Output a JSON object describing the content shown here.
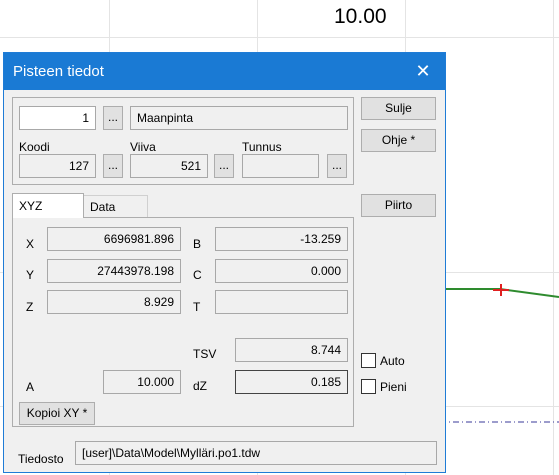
{
  "background": {
    "value_label": "10.00"
  },
  "dialog": {
    "title": "Pisteen tiedot",
    "close_symbol": "✕",
    "point_number": "1",
    "browse_label": "...",
    "point_name": "Maanpinta",
    "koodi": {
      "label": "Koodi",
      "value": "127"
    },
    "viiva": {
      "label": "Viiva",
      "value": "521"
    },
    "tunnus": {
      "label": "Tunnus",
      "value": ""
    },
    "buttons": {
      "sulje": "Sulje",
      "ohje": "Ohje *",
      "piirto": "Piirto",
      "kopioi": "Kopioi XY *"
    },
    "tabs": [
      {
        "label": "XYZ",
        "active": true
      },
      {
        "label": "Data",
        "active": false
      }
    ],
    "coords": {
      "x": {
        "label": "X",
        "value": "6696981.896"
      },
      "y": {
        "label": "Y",
        "value": "27443978.198"
      },
      "z": {
        "label": "Z",
        "value": "8.929"
      },
      "b": {
        "label": "B",
        "value": "-13.259"
      },
      "c": {
        "label": "C",
        "value": "0.000"
      },
      "t": {
        "label": "T",
        "value": ""
      },
      "tsv": {
        "label": "TSV",
        "value": "8.744"
      },
      "a": {
        "label": "A",
        "value": "10.000"
      },
      "dz": {
        "label": "dZ",
        "value": "0.185"
      }
    },
    "checkboxes": [
      {
        "label": "Auto",
        "checked": false
      },
      {
        "label": "Pieni",
        "checked": false
      }
    ],
    "file": {
      "label": "Tiedosto",
      "value": "[user]\\Data\\Model\\Mylläri.po1.tdw"
    }
  },
  "colors": {
    "titlebar": "#1a7ad4",
    "line": "#2e8b2e",
    "marker": "#e02020"
  }
}
